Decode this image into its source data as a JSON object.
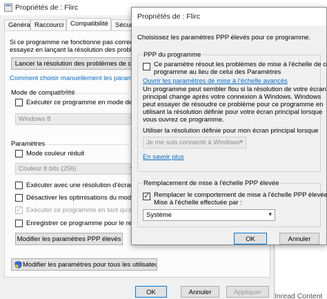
{
  "back_window": {
    "title": "Propriétés de : Flirc",
    "tabs": [
      "Général",
      "Raccourci",
      "Compatibilité",
      "Sécurit"
    ],
    "intro_line1": "Si ce programme ne fonctionne pas correcte",
    "intro_line2": "essayez en lançant la résolution des problè",
    "troubleshoot_button": "Lancer la résolution des problèmes de c",
    "manual_link": "Comment choisir manuellement les paramètre",
    "compat_mode": {
      "heading": "Mode de compatibilité",
      "checkbox_label": "Exécuter ce programme en mode de c",
      "checked": false,
      "select_value": "Windows 8"
    },
    "settings": {
      "heading": "Paramètres",
      "reduced_color_label": "Mode couleur réduit",
      "reduced_color_checked": false,
      "color_select_value": "Couleur 8 bits (256)",
      "low_res_label": "Exécuter avec une résolution d'écran d",
      "low_res_checked": false,
      "disable_fullscreen_label": "Désactiver les optimisations du mode p",
      "disable_fullscreen_checked": false,
      "run_admin_label": "Exécuter ce programme en tant qu'adn",
      "run_admin_checked": true,
      "register_label": "Enregistrer ce programme pour le redé",
      "register_checked": false,
      "dpi_button": "Modifier les paramètres PPP élevés"
    },
    "all_users_button": "Modifier les paramètres pour tous les utilisateurs",
    "footer": {
      "ok": "OK",
      "cancel": "Annuler",
      "apply": "Appliquer"
    }
  },
  "dialog": {
    "title": "Propriétés de : Flirc",
    "choose_text": "Choisissez les paramètres PPP élevés pour ce programme.",
    "program_dpi": {
      "heading": "PPP du programme",
      "checkbox_line1": "Ce paramètre résout les problèmes de mise à l'échelle de ce",
      "checkbox_line2": "programme au lieu de celui des Paramètres",
      "checked": false,
      "advanced_link": "Ouvrir les paramètres de mise à l'échelle avancés",
      "para_lines": [
        "Un programme peut sembler flou si la résolution de votre écran",
        "principal change après votre connexion à Windows. Windows",
        "peut essayer de résoudre ce problème pour ce programme en",
        "utilisant la résolution définie pour votre écran principal lorsque",
        "vous ouvrez ce programme."
      ],
      "use_resolution_label": "Utiliser la résolution définie pour mon écran principal lorsque",
      "use_resolution_select": "Je me suis connecté à Windows",
      "learn_more_link": "En savoir plus"
    },
    "override": {
      "heading": "Remplacement de mise à l'échelle PPP élevée",
      "checkbox_line1": "Remplacer le comportement de mise à l'échelle PPP élevée.",
      "checkbox_line2": "Mise à l'échelle effectuée par :",
      "checked": true,
      "select_value": "Système"
    },
    "footer": {
      "ok": "OK",
      "cancel": "Annuler"
    }
  },
  "background_text": "Inread Content"
}
